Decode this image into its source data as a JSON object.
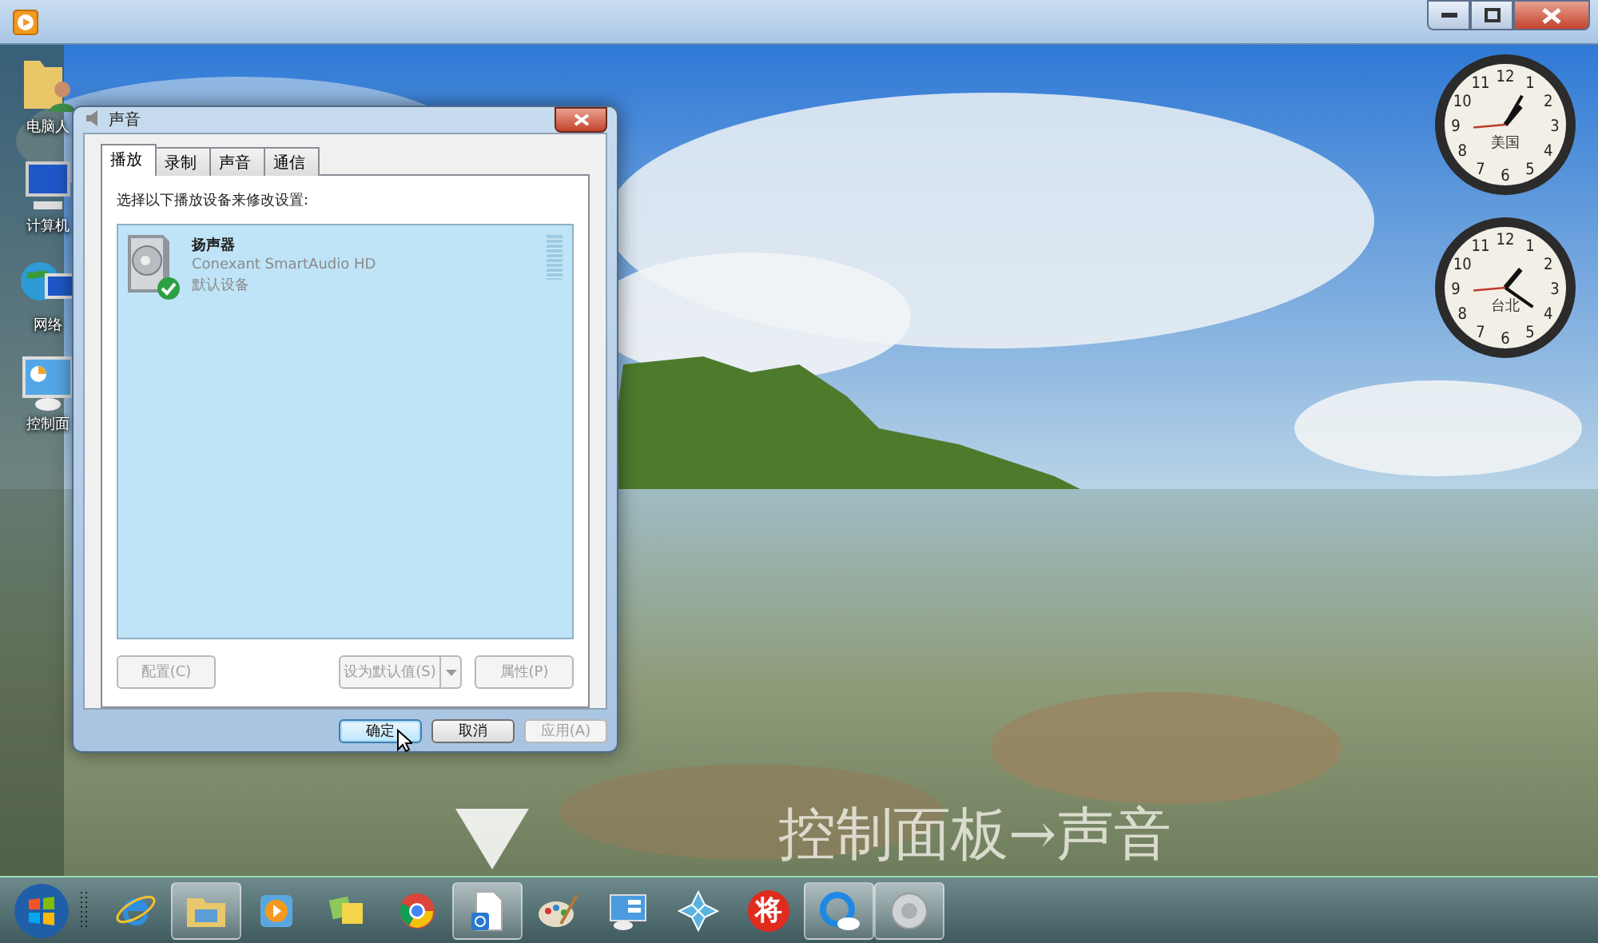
{
  "desktop_icons": [
    {
      "kind": "user-folder",
      "label": "电脑人"
    },
    {
      "kind": "computer",
      "label": "计算机"
    },
    {
      "kind": "network",
      "label": "网络"
    },
    {
      "kind": "control-panel",
      "label": "控制面"
    }
  ],
  "clocks": [
    {
      "city": "美国",
      "numerals": [
        "12",
        "11",
        "1",
        "10",
        "2",
        "9",
        "3",
        "8",
        "4",
        "7",
        "5",
        "6"
      ]
    },
    {
      "city": "台北",
      "numerals": [
        "12",
        "11",
        "1",
        "10",
        "2",
        "9",
        "3",
        "8",
        "4",
        "7",
        "5",
        "6"
      ]
    }
  ],
  "dialog": {
    "title": "声音",
    "tabs": [
      {
        "label": "播放",
        "selected": true
      },
      {
        "label": "录制",
        "selected": false
      },
      {
        "label": "声音",
        "selected": false
      },
      {
        "label": "通信",
        "selected": false
      }
    ],
    "instruction": "选择以下播放设备来修改设置:",
    "devices": [
      {
        "name": "扬声器",
        "driver": "Conexant SmartAudio HD",
        "status": "默认设备",
        "default": true,
        "level": 0
      }
    ],
    "device_buttons": [
      {
        "label": "配置(C)",
        "kind": "plain",
        "disabled": true
      },
      {
        "label": "设为默认值(S)",
        "kind": "split",
        "disabled": true
      },
      {
        "label": "属性(P)",
        "kind": "plain",
        "disabled": true
      }
    ],
    "footer_buttons": [
      {
        "label": "确定",
        "disabled": false,
        "focused": true
      },
      {
        "label": "取消",
        "disabled": false,
        "focused": false
      },
      {
        "label": "应用(A)",
        "disabled": true,
        "focused": false
      }
    ]
  },
  "caption": "控制面板→声音",
  "taskbar": {
    "items": [
      {
        "kind": "browser",
        "running": false
      },
      {
        "kind": "folder",
        "running": true
      },
      {
        "kind": "media",
        "running": false
      },
      {
        "kind": "notes",
        "running": false
      },
      {
        "kind": "chrome",
        "running": false
      },
      {
        "kind": "document",
        "running": true
      },
      {
        "kind": "paint",
        "running": false
      },
      {
        "kind": "control-panel",
        "running": false
      },
      {
        "kind": "pinwheel",
        "running": false
      },
      {
        "kind": "badge",
        "text": "将",
        "running": false
      },
      {
        "kind": "cloud",
        "running": true
      },
      {
        "kind": "speaker",
        "running": true
      }
    ]
  }
}
